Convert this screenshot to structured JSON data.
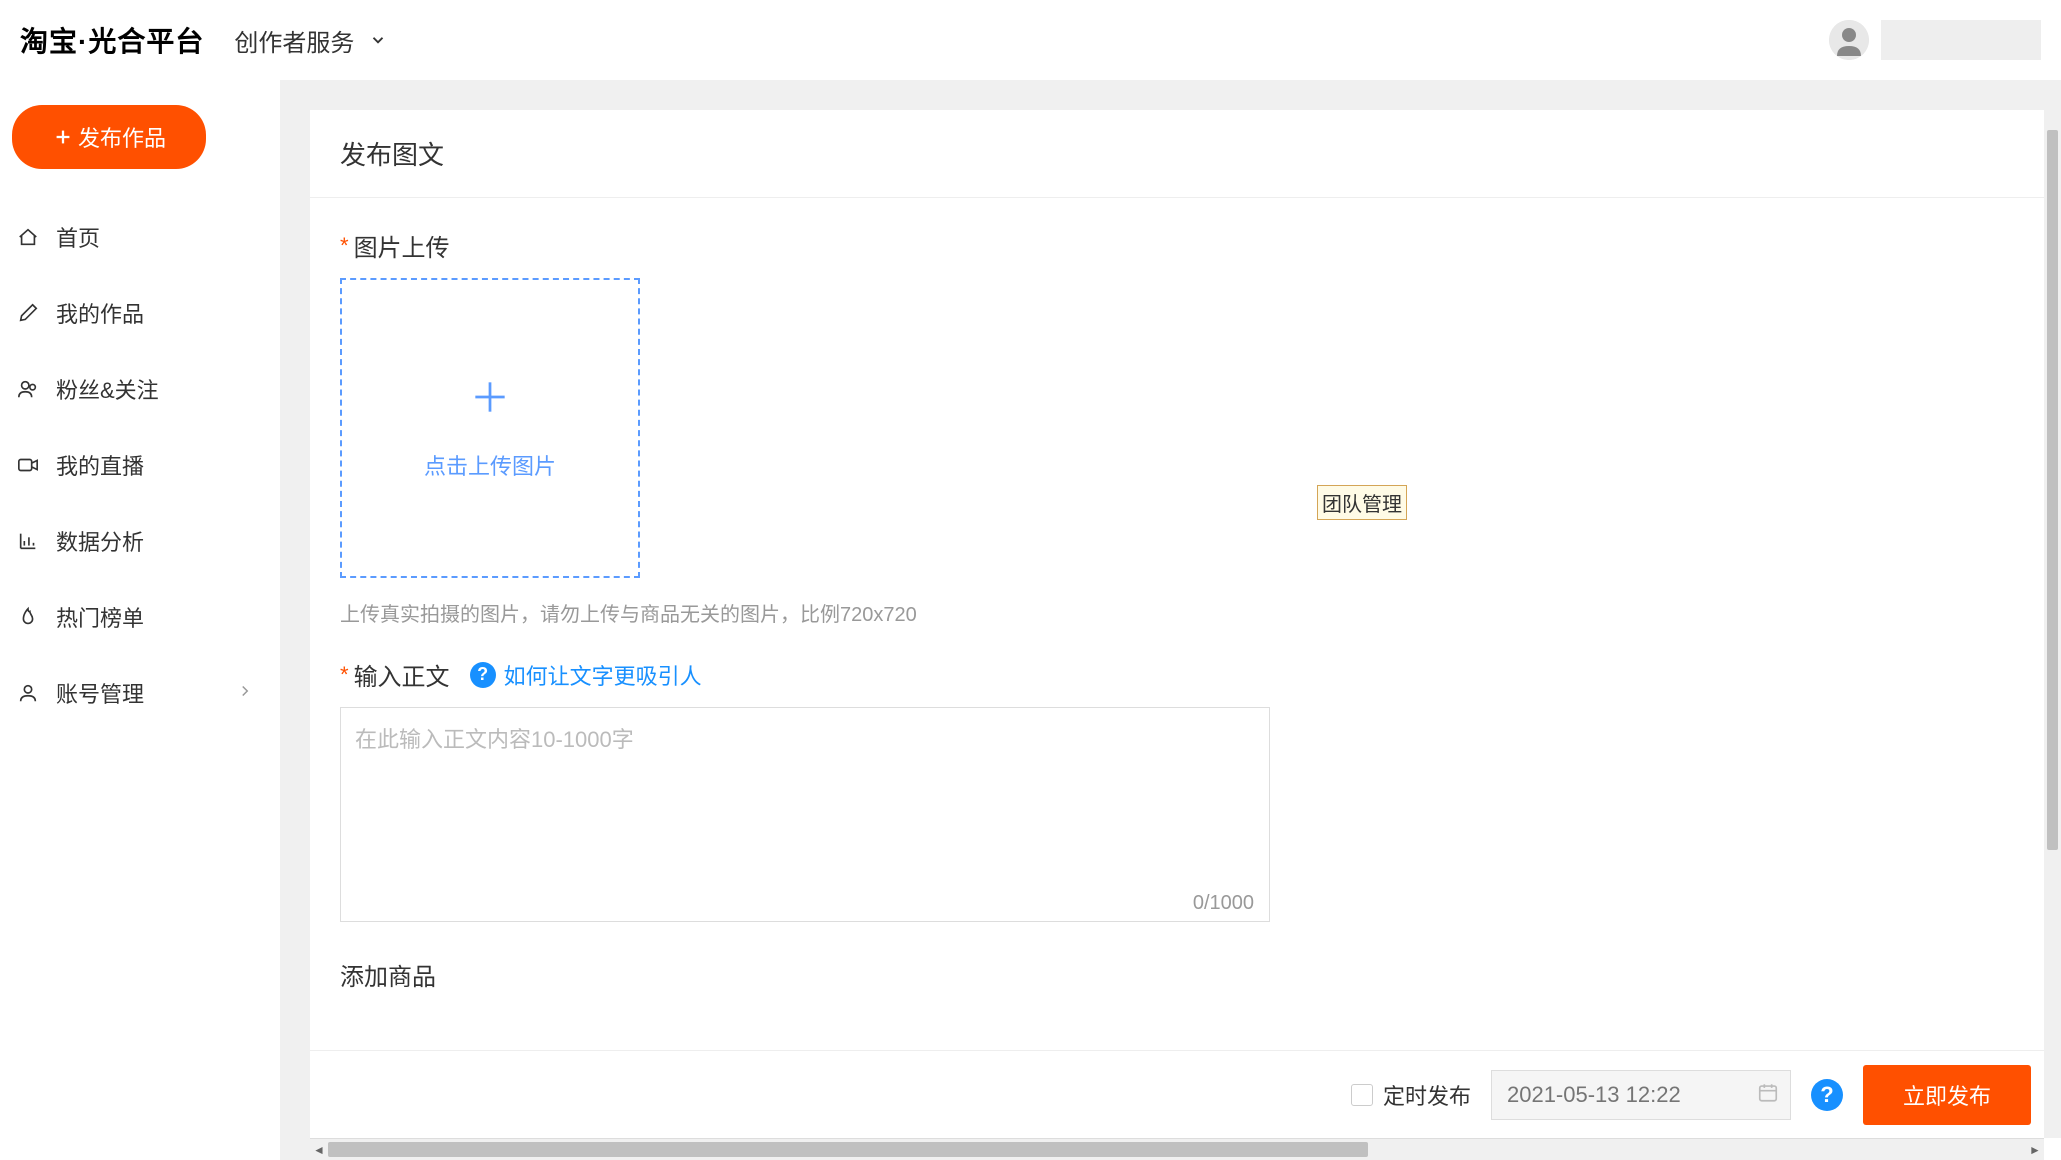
{
  "header": {
    "logo": "淘宝·光合平台",
    "service_label": "创作者服务"
  },
  "sidebar": {
    "publish_btn": "发布作品",
    "items": [
      {
        "label": "首页",
        "icon": "home-icon"
      },
      {
        "label": "我的作品",
        "icon": "pen-icon"
      },
      {
        "label": "粉丝&关注",
        "icon": "fans-icon"
      },
      {
        "label": "我的直播",
        "icon": "video-icon"
      },
      {
        "label": "数据分析",
        "icon": "chart-icon"
      },
      {
        "label": "热门榜单",
        "icon": "fire-icon"
      },
      {
        "label": "账号管理",
        "icon": "user-icon",
        "expandable": true
      }
    ]
  },
  "main": {
    "page_title": "发布图文",
    "upload": {
      "label": "图片上传",
      "box_text": "点击上传图片",
      "hint": "上传真实拍摄的图片，请勿上传与商品无关的图片，比例720x720"
    },
    "content": {
      "label": "输入正文",
      "help_text": "如何让文字更吸引人",
      "placeholder": "在此输入正文内容10-1000字",
      "char_count": "0/1000"
    },
    "add_product": {
      "label": "添加商品"
    },
    "tooltip": "团队管理",
    "footer": {
      "schedule_label": "定时发布",
      "date_placeholder": "2021-05-13 12:22",
      "submit_label": "立即发布"
    }
  }
}
